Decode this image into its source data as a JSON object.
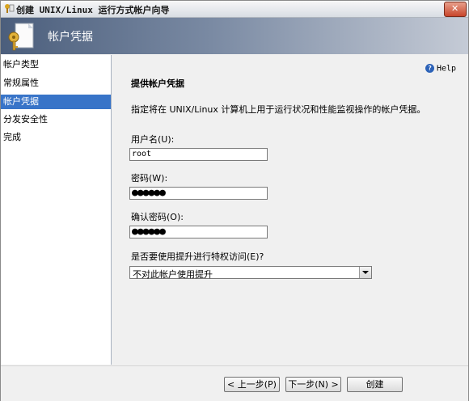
{
  "window": {
    "title": "创建 UNIX/Linux 运行方式帐户向导"
  },
  "header": {
    "title": "帐户凭据"
  },
  "nav": {
    "items": [
      {
        "label": "帐户类型"
      },
      {
        "label": "常规属性"
      },
      {
        "label": "帐户凭据"
      },
      {
        "label": "分发安全性"
      },
      {
        "label": "完成"
      }
    ],
    "active_index": 2
  },
  "content": {
    "help_label": "Help",
    "section_title": "提供帐户凭据",
    "description": "指定将在 UNIX/Linux 计算机上用于运行状况和性能监视操作的帐户凭据。",
    "username": {
      "label": "用户名(U):",
      "value": "root"
    },
    "password": {
      "label": "密码(W):",
      "value": "●●●●●●"
    },
    "confirm_password": {
      "label": "确认密码(O):",
      "value": "●●●●●●"
    },
    "elevation": {
      "label": "是否要使用提升进行特权访问(E)?",
      "selected": "不对此帐户使用提升"
    }
  },
  "footer": {
    "back_label": "< 上一步(P)",
    "next_label": "下一步(N) >",
    "create_label": "创建"
  }
}
